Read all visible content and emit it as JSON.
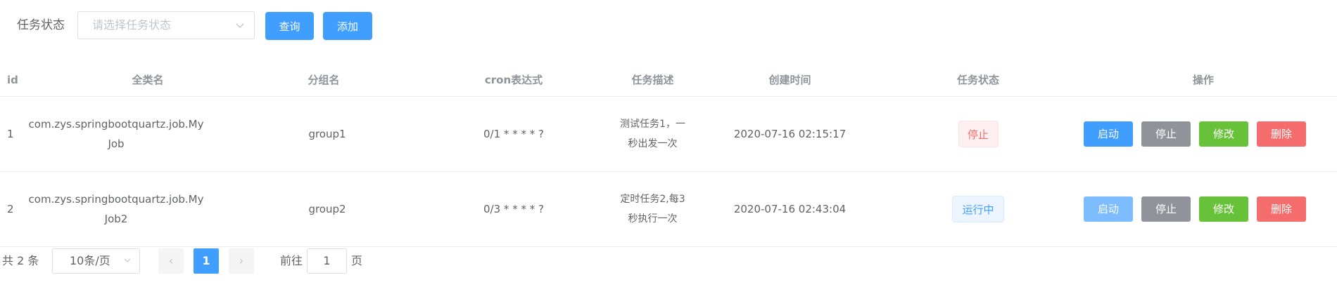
{
  "filter": {
    "label": "任务状态",
    "placeholder": "请选择任务状态",
    "query_label": "查询",
    "add_label": "添加"
  },
  "table": {
    "headers": [
      "id",
      "全类名",
      "分组名",
      "cron表达式",
      "任务描述",
      "创建时间",
      "任务状态",
      "操作"
    ],
    "rows": [
      {
        "id": "1",
        "class_line1": "com.zys.springbootquartz.job.My",
        "class_line2": "Job",
        "group": "group1",
        "cron": "0/1 * * * * ?",
        "desc_line1": "测试任务1，一",
        "desc_line2": "秒出发一次",
        "created": "2020-07-16 02:15:17",
        "status": "停止",
        "ops": [
          "启动",
          "停止",
          "修改",
          "删除"
        ]
      },
      {
        "id": "2",
        "class_line1": "com.zys.springbootquartz.job.My",
        "class_line2": "Job2",
        "group": "group2",
        "cron": "0/3 * * * * ?",
        "desc_line1": "定时任务2,每3",
        "desc_line2": "秒执行一次",
        "created": "2020-07-16 02:43:04",
        "status": "运行中",
        "ops": [
          "启动",
          "停止",
          "修改",
          "删除"
        ]
      }
    ]
  },
  "pager": {
    "total": "共 2 条",
    "page_size": "10条/页",
    "prev": "‹",
    "current": "1",
    "next": "›",
    "goto": "前往",
    "goto_value": "1",
    "page_suffix": "页"
  },
  "colors": {
    "primary": "#409eff",
    "info": "#909399",
    "success": "#67c23a",
    "danger": "#f56c6c"
  }
}
